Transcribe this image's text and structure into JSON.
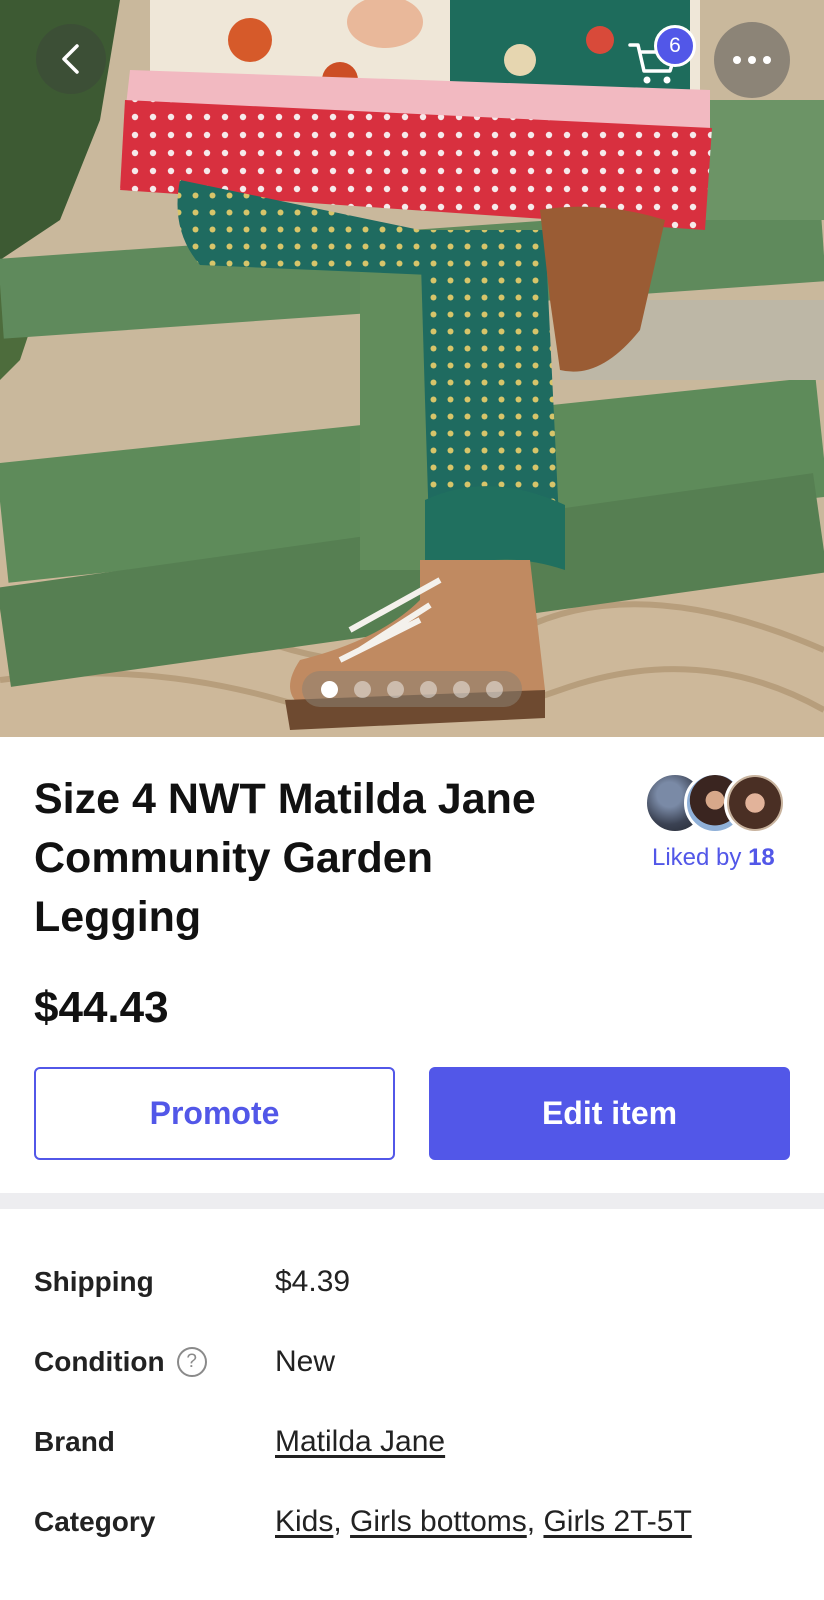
{
  "header": {
    "cart_count": "6"
  },
  "gallery": {
    "image_count": 6,
    "active_index": 0
  },
  "item": {
    "title_line1": "Size 4 NWT Matilda Jane",
    "title_line2": "Community Garden",
    "title_line3": "Legging",
    "price": "$44.43"
  },
  "likes": {
    "prefix": "Liked by",
    "count": "18"
  },
  "actions": {
    "promote_label": "Promote",
    "edit_label": "Edit item"
  },
  "details": {
    "shipping_label": "Shipping",
    "shipping_value": "$4.39",
    "condition_label": "Condition",
    "condition_help": "?",
    "condition_value": "New",
    "brand_label": "Brand",
    "brand_value": "Matilda Jane",
    "category_label": "Category",
    "categories": [
      "Kids",
      "Girls bottoms",
      "Girls 2T-5T"
    ],
    "separator": ","
  },
  "colors": {
    "accent": "#5257e8",
    "divider": "#ededf0",
    "text": "#222222"
  }
}
